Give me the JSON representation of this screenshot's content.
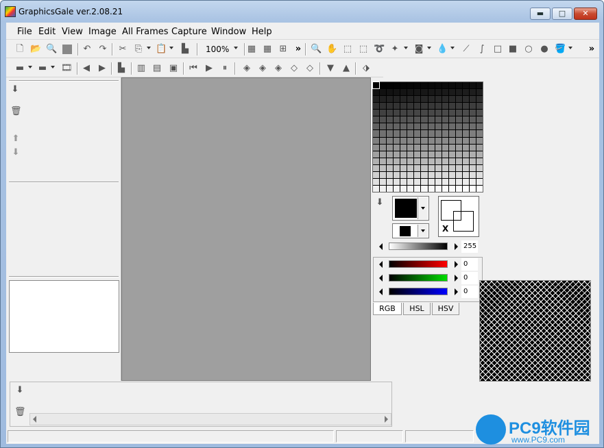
{
  "window": {
    "title": "GraphicsGale ver.2.08.21"
  },
  "caption_buttons": {
    "minimize": "▬",
    "maximize": "□",
    "close": "✕"
  },
  "menu": [
    "File",
    "Edit",
    "View",
    "Image",
    "All Frames",
    "Capture",
    "Window",
    "Help"
  ],
  "toolbar": {
    "zoom": "100%",
    "overflow": "»"
  },
  "toolbar2_overflow": "»",
  "palette": {
    "brightness_value": "255",
    "red_value": "0",
    "green_value": "0",
    "blue_value": "0",
    "tabs": [
      "RGB",
      "HSL",
      "HSV"
    ],
    "swap_label": "X",
    "colors": {
      "fg": "#000000",
      "bg": "#000000",
      "red": "#ff0000",
      "green": "#00dd00",
      "blue": "#0000ff"
    }
  },
  "watermark": {
    "text": "PC9软件园",
    "sub": "www.PC9.com"
  }
}
